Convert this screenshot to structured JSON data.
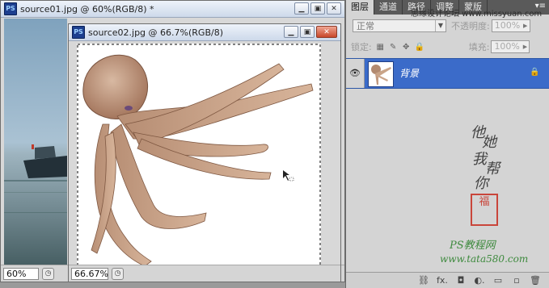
{
  "window1": {
    "app_icon": "PS",
    "title": "source01.jpg @ 60%(RGB/8) *",
    "zoom": "60%"
  },
  "window2": {
    "app_icon": "PS",
    "title": "source02.jpg @ 66.7%(RGB/8)",
    "zoom": "66.67%"
  },
  "panel": {
    "tabs": [
      "图层",
      "通道",
      "路径",
      "调整",
      "蒙版"
    ],
    "menu_icon": "▾≡",
    "blend_mode": "正常",
    "opacity_label": "不透明度:",
    "opacity_value": "100%",
    "lock_label": "锁定:",
    "fill_label": "填充:",
    "fill_value": "100%",
    "layer_name": "背景",
    "bottom_icons": [
      "link-icon",
      "fx-icon",
      "mask-icon",
      "adjustment-icon",
      "group-icon",
      "new-layer-icon",
      "trash-icon"
    ],
    "bottom_glyphs": [
      "⛓",
      "fx.",
      "◘",
      "◐.",
      "▭",
      "▫",
      "🗑"
    ]
  },
  "watermark": {
    "top": "思缘设计论坛 www.missyuan.com",
    "vertical_chars": [
      "他",
      "她",
      "我",
      "帮",
      "你"
    ],
    "seal": "福",
    "line1": "PS教程网",
    "line2": "www.tata580.com"
  },
  "colors": {
    "title_gradient_top": "#eef3fa",
    "layer_selected": "#3b6bc9",
    "close_button": "#c8472a",
    "watermark_green": "#3e8a3e",
    "seal_red": "#c9453a"
  }
}
